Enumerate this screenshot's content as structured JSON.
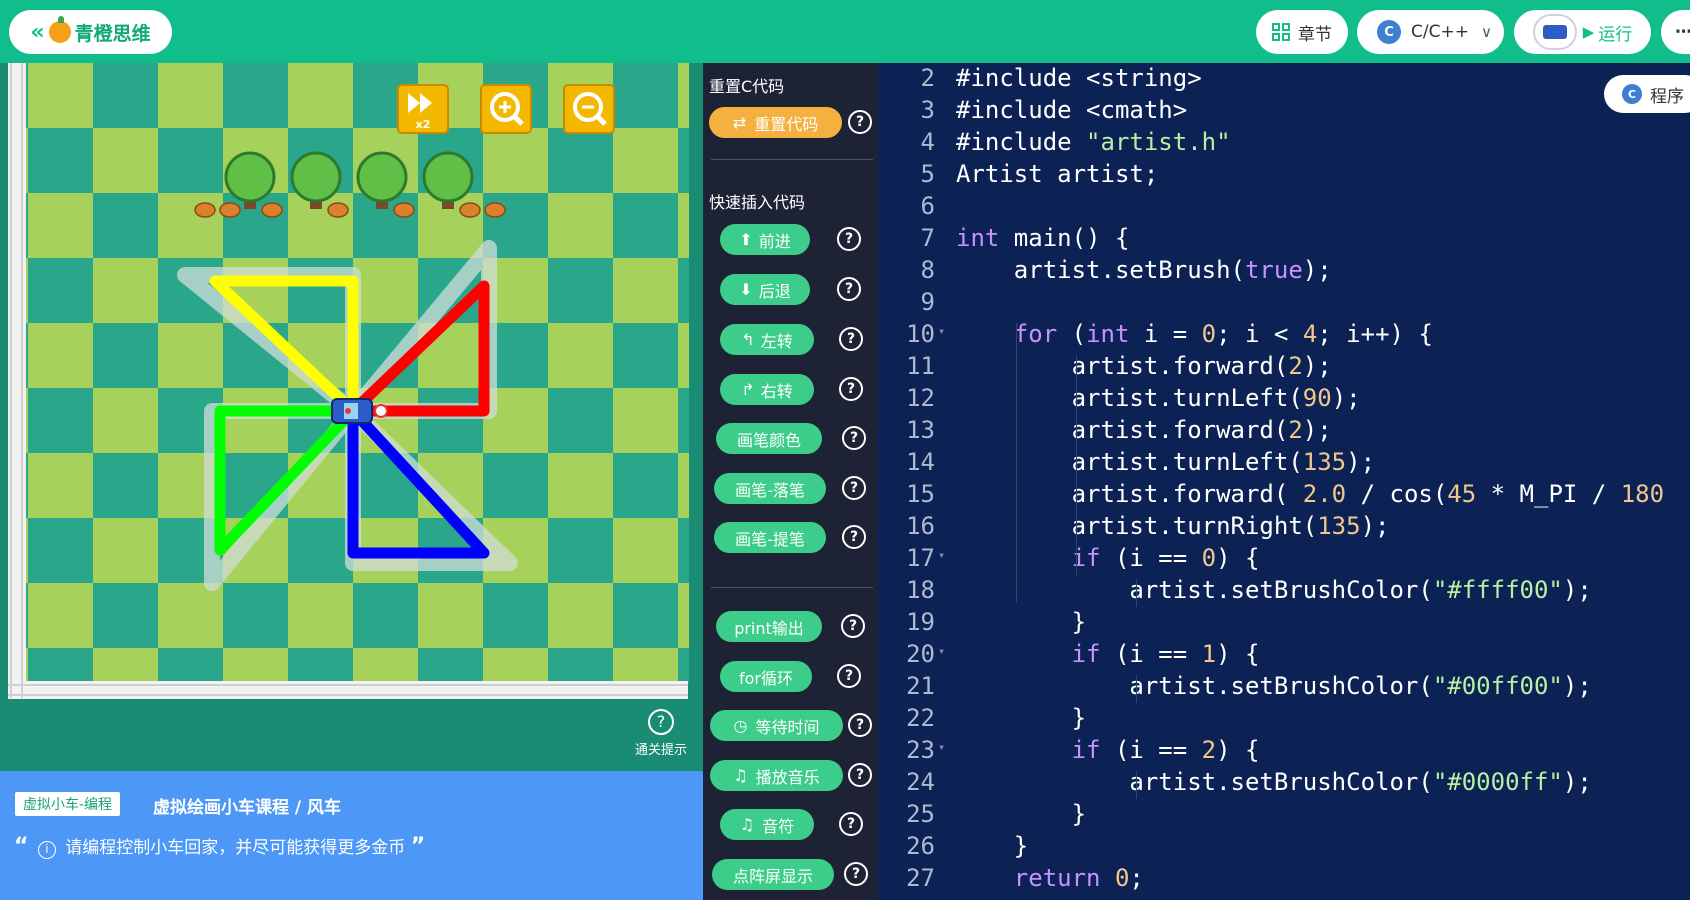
{
  "header": {
    "back_icon": "double-chevron-left-icon",
    "brand": "青橙思维",
    "chapter_label": "章节",
    "language": "C/C++",
    "run_label": "运行",
    "more": "⋯"
  },
  "game": {
    "speed_label": "x2",
    "hint_label": "通关提示",
    "colors": {
      "yellow": "#ffff00",
      "green": "#00ff00",
      "blue": "#0000ff",
      "red": "#ff0000"
    }
  },
  "info": {
    "tag": "虚拟小车-编程",
    "course": "虚拟绘画小车课程 / 风车",
    "tip": "请编程控制小车回家，并尽可能获得更多金币"
  },
  "panel": {
    "reset_title": "重置C代码",
    "reset_button": "重置代码",
    "quick_title": "快速插入代码",
    "qmark": "?",
    "buttons": [
      "前进",
      "后退",
      "左转",
      "右转",
      "画笔颜色",
      "画笔-落笔",
      "画笔-提笔"
    ],
    "buttons2": [
      "print输出",
      "for循环",
      "等待时间",
      "播放音乐",
      "音符",
      "点阵屏显示"
    ]
  },
  "editor": {
    "program_label": "程序",
    "lines": [
      {
        "n": "2",
        "t": "#include <string>"
      },
      {
        "n": "3",
        "t": "#include <cmath>"
      },
      {
        "n": "4",
        "t": "#include \"artist.h\""
      },
      {
        "n": "5",
        "t": "Artist artist;"
      },
      {
        "n": "6",
        "t": ""
      },
      {
        "n": "7",
        "t": "int main() {"
      },
      {
        "n": "8",
        "t": "    artist.setBrush(true);"
      },
      {
        "n": "9",
        "t": ""
      },
      {
        "n": "10",
        "t": "    for (int i = 0; i < 4; i++) {"
      },
      {
        "n": "11",
        "t": "        artist.forward(2);"
      },
      {
        "n": "12",
        "t": "        artist.turnLeft(90);"
      },
      {
        "n": "13",
        "t": "        artist.forward(2);"
      },
      {
        "n": "14",
        "t": "        artist.turnLeft(135);"
      },
      {
        "n": "15",
        "t": "        artist.forward( 2.0 / cos(45 * M_PI / 180"
      },
      {
        "n": "16",
        "t": "        artist.turnRight(135);"
      },
      {
        "n": "17",
        "t": "        if (i == 0) {"
      },
      {
        "n": "18",
        "t": "            artist.setBrushColor(\"#ffff00\");"
      },
      {
        "n": "19",
        "t": "        }"
      },
      {
        "n": "20",
        "t": "        if (i == 1) {"
      },
      {
        "n": "21",
        "t": "            artist.setBrushColor(\"#00ff00\");"
      },
      {
        "n": "22",
        "t": "        }"
      },
      {
        "n": "23",
        "t": "        if (i == 2) {"
      },
      {
        "n": "24",
        "t": "            artist.setBrushColor(\"#0000ff\");"
      },
      {
        "n": "25",
        "t": "        }"
      },
      {
        "n": "26",
        "t": "    }"
      },
      {
        "n": "27",
        "t": "    return 0;"
      }
    ]
  }
}
